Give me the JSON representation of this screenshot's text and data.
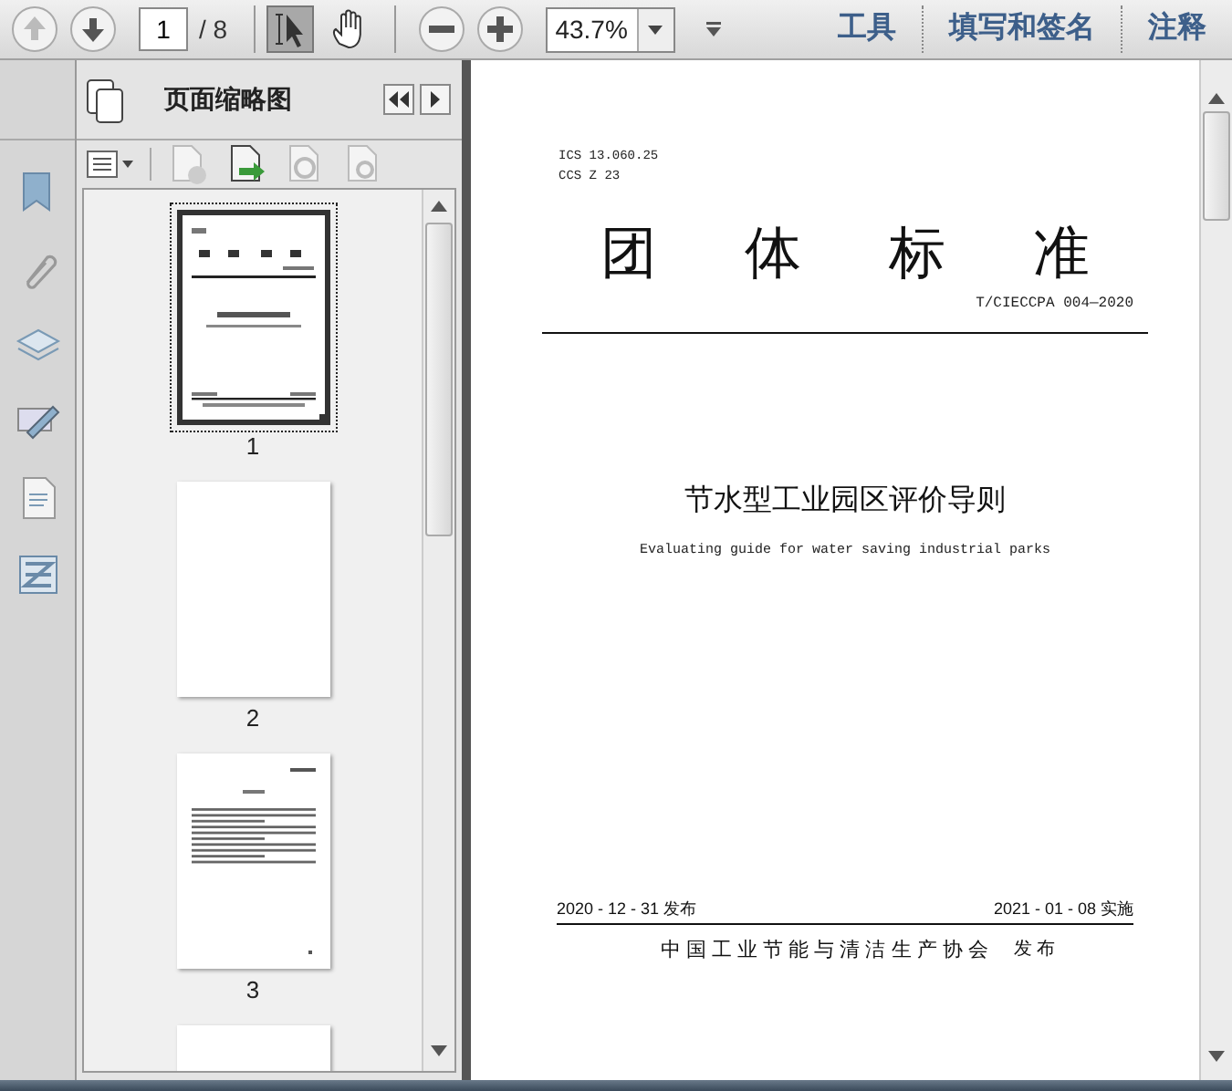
{
  "toolbar": {
    "page_input": "1",
    "page_total": "/ 8",
    "zoom": "43.7%",
    "tools": [
      {
        "kind": "select",
        "selected": true
      },
      {
        "kind": "hand",
        "selected": false
      }
    ],
    "prev_disabled": true,
    "links": [
      "工具",
      "填写和签名",
      "注释"
    ]
  },
  "panel": {
    "title": "页面缩略图",
    "thumbnails": [
      {
        "label": "1",
        "selected": true,
        "kind": "cover"
      },
      {
        "label": "2",
        "selected": false,
        "kind": "blank"
      },
      {
        "label": "3",
        "selected": false,
        "kind": "text"
      },
      {
        "selected": false,
        "kind": "blank"
      }
    ]
  },
  "document": {
    "codes": [
      "ICS 13.060.25",
      "CCS Z 23"
    ],
    "heading": [
      "团",
      "体",
      "标",
      "准"
    ],
    "number": "T/CIECCPA 004—2020",
    "title": "节水型工业园区评价导则",
    "subtitle": "Evaluating guide for water saving industrial parks",
    "issue_date": "2020 - 12 - 31 发布",
    "effective_date": "2021 - 01 - 08 实施",
    "publisher": "中 国 工 业 节 能 与 清 洁 生 产 协 会",
    "publisher_suffix": "发 布"
  }
}
